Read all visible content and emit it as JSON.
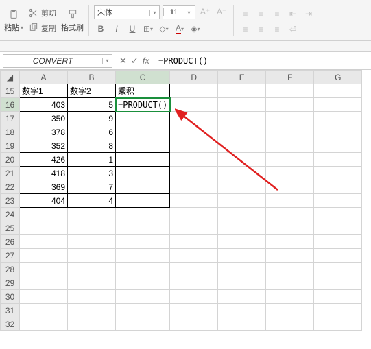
{
  "toolbar": {
    "paste_label": "粘贴",
    "cut_label": "剪切",
    "copy_label": "复制",
    "format_painter_label": "格式刷",
    "font_name": "宋体",
    "font_size": "11",
    "bold": "B",
    "italic": "I",
    "underline": "U"
  },
  "formula_bar": {
    "name_box": "CONVERT",
    "formula": "=PRODUCT()"
  },
  "grid": {
    "col_headers": [
      "A",
      "B",
      "C",
      "D",
      "E",
      "F",
      "G"
    ],
    "row_start": 15,
    "row_end": 32,
    "headers": {
      "A15": "数字1",
      "B15": "数字2",
      "C15": "乘积"
    },
    "active_cell_content": "=PRODUCT()",
    "data": [
      {
        "a": 403,
        "b": 5
      },
      {
        "a": 350,
        "b": 9
      },
      {
        "a": 378,
        "b": 6
      },
      {
        "a": 352,
        "b": 8
      },
      {
        "a": 426,
        "b": 1
      },
      {
        "a": 418,
        "b": 3
      },
      {
        "a": 369,
        "b": 7
      },
      {
        "a": 404,
        "b": 4
      }
    ]
  },
  "chart_data": {
    "type": "table",
    "title": "",
    "columns": [
      "数字1",
      "数字2",
      "乘积"
    ],
    "rows": [
      [
        403,
        5,
        null
      ],
      [
        350,
        9,
        null
      ],
      [
        378,
        6,
        null
      ],
      [
        352,
        8,
        null
      ],
      [
        426,
        1,
        null
      ],
      [
        418,
        3,
        null
      ],
      [
        369,
        7,
        null
      ],
      [
        404,
        4,
        null
      ]
    ]
  }
}
